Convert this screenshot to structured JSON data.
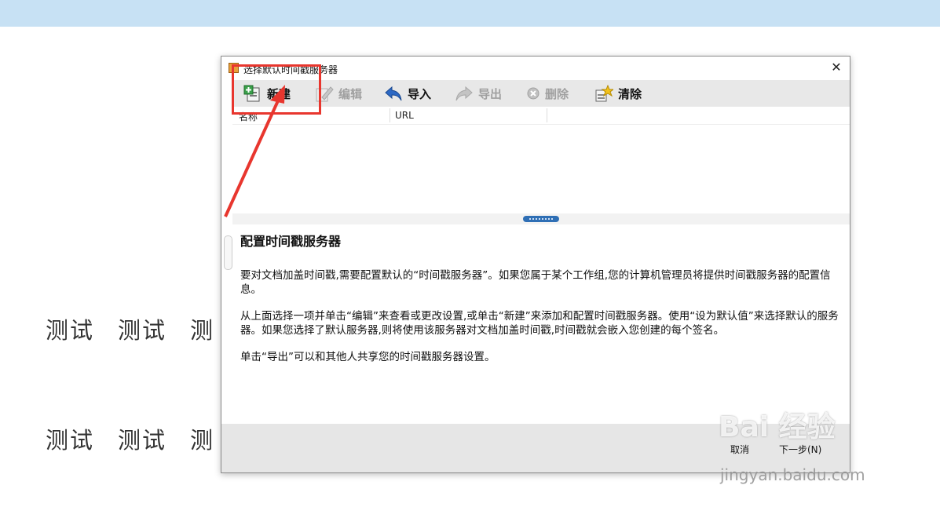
{
  "background": {
    "row1": [
      "测试",
      "测试",
      "测"
    ],
    "row2": [
      "测试",
      "测试",
      "测"
    ]
  },
  "dialog": {
    "title": "选择默认时间戳服务器",
    "close_glyph": "✕",
    "toolbar": {
      "new_label": "新建",
      "edit_label": "编辑",
      "import_label": "导入",
      "export_label": "导出",
      "delete_label": "删除",
      "clear_label": "清除"
    },
    "list": {
      "col_name": "名称",
      "col_url": "URL"
    },
    "description": {
      "heading": "配置时间戳服务器",
      "p1": "要对文档加盖时间戳,需要配置默认的“时间戳服务器”。如果您属于某个工作组,您的计算机管理员将提供时间戳服务器的配置信息。",
      "p2": "从上面选择一项并单击“编辑”来查看或更改设置,或单击“新建”来添加和配置时间戳服务器。使用“设为默认值”来选择默认的服务器。如果您选择了默认服务器,则将使用该服务器对文档加盖时间戳,时间戳就会嵌入您创建的每个签名。",
      "p3": "单击“导出”可以和其他人共享您的时间戳服务器设置。"
    },
    "footer": {
      "cancel_label": "取消",
      "next_label": "下一步(N)"
    }
  },
  "watermark": {
    "logo": "Bai 经验",
    "sub": "jingyan.baidu.com"
  },
  "colors": {
    "accent_red": "#e8362e",
    "top_bar": "#c7e1f4",
    "splitter_handle": "#2f6fb5"
  }
}
